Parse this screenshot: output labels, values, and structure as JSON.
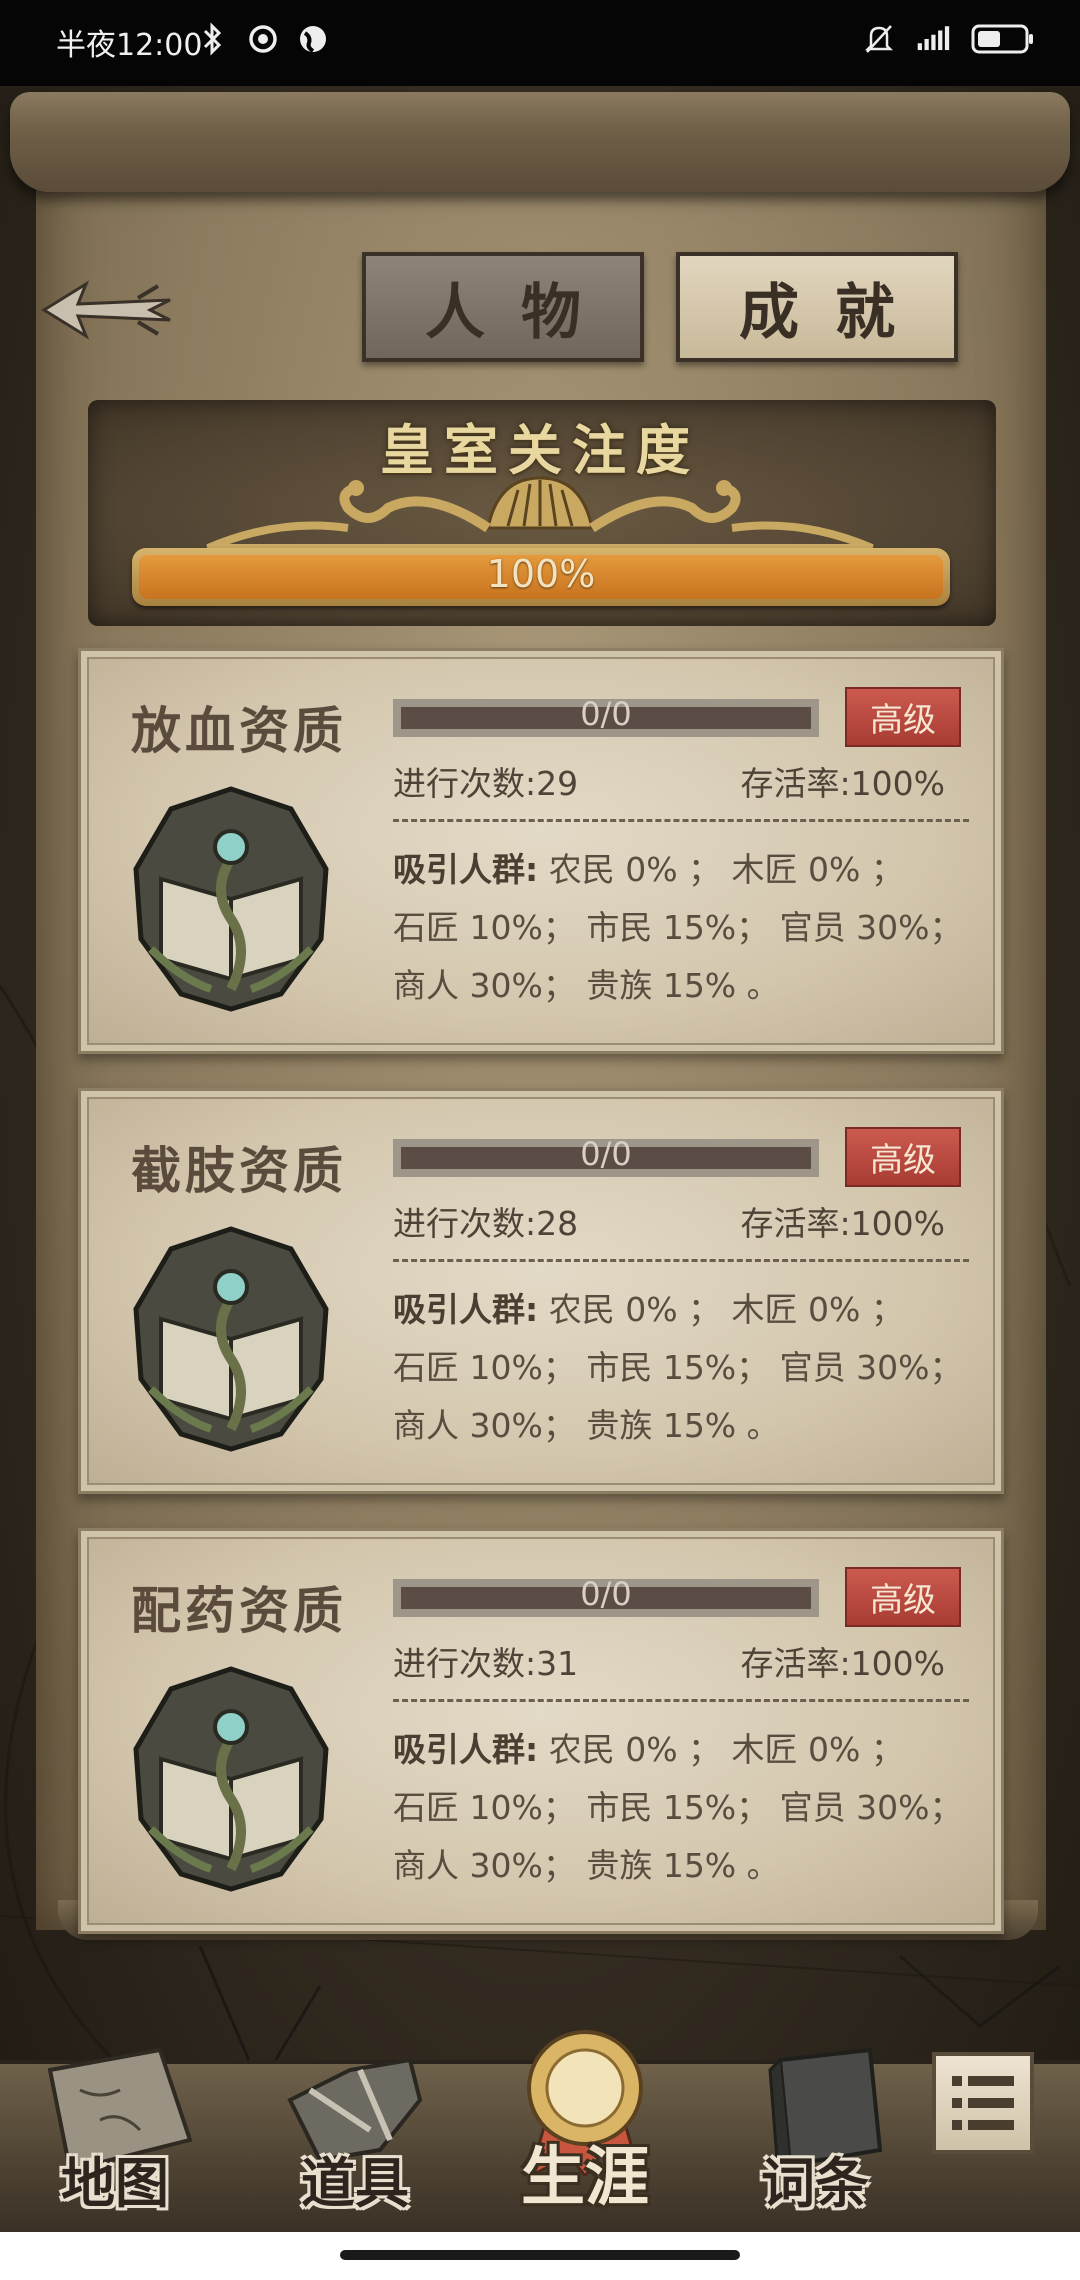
{
  "status_bar": {
    "time": "半夜12:00",
    "icons": [
      "bluetooth-icon",
      "sync-icon",
      "globe-icon",
      "mute-bell-icon",
      "signal-icon",
      "battery-icon"
    ]
  },
  "header": {
    "back_icon": "arrow-left-icon",
    "tabs": [
      {
        "label": "人物",
        "active": true
      },
      {
        "label": "成就",
        "active": false
      }
    ]
  },
  "royal_attention": {
    "title": "皇室关注度",
    "progress_text": "100%",
    "progress_value": 1.0
  },
  "cards": [
    {
      "title": "放血资质",
      "progress_text": "0/0",
      "badge": "高级",
      "count_text": "进行次数:29",
      "survival_text": "存活率:100%",
      "attract_label": "吸引人群:",
      "attract_line1": "农民 0% ； 木匠 0% ；",
      "attract_line2": "石匠 10%； 市民 15%； 官员 30%；",
      "attract_line3": "商人 30%； 贵族 15% 。"
    },
    {
      "title": "截肢资质",
      "progress_text": "0/0",
      "badge": "高级",
      "count_text": "进行次数:28",
      "survival_text": "存活率:100%",
      "attract_label": "吸引人群:",
      "attract_line1": "农民 0% ； 木匠 0% ；",
      "attract_line2": "石匠 10%； 市民 15%； 官员 30%；",
      "attract_line3": "商人 30%； 贵族 15% 。"
    },
    {
      "title": "配药资质",
      "progress_text": "0/0",
      "badge": "高级",
      "count_text": "进行次数:31",
      "survival_text": "存活率:100%",
      "attract_label": "吸引人群:",
      "attract_line1": "农民 0% ； 木匠 0% ；",
      "attract_line2": "石匠 10%； 市民 15%； 官员 30%；",
      "attract_line3": "商人 30%； 贵族 15% 。"
    }
  ],
  "bottom_nav": {
    "items": [
      {
        "label": "地图",
        "icon": "map-icon",
        "active": false
      },
      {
        "label": "道具",
        "icon": "tools-icon",
        "active": false
      },
      {
        "label": "生涯",
        "icon": "medal-icon",
        "active": true
      },
      {
        "label": "词条",
        "icon": "book-icon",
        "active": false
      }
    ],
    "menu_icon": "list-menu-icon"
  },
  "colors": {
    "badge_red": "#b8473d",
    "progress_orange": "#d8842c",
    "parchment": "#d3c6ad",
    "dark_bg": "#2b241b"
  }
}
